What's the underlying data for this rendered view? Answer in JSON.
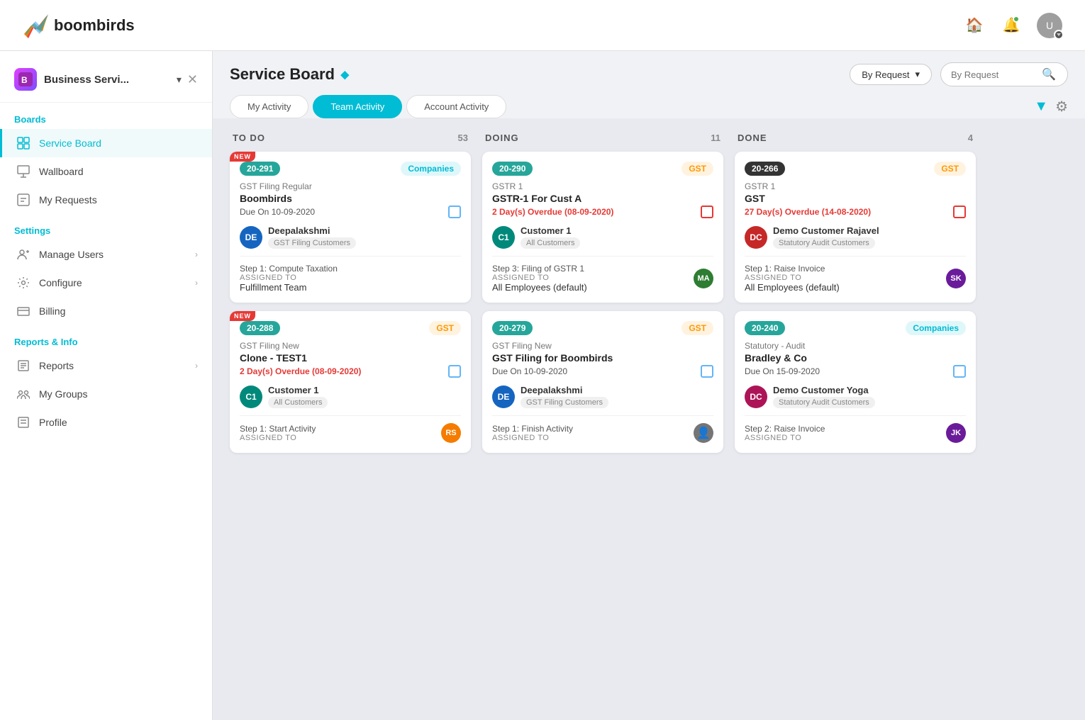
{
  "app": {
    "name": "boombirds"
  },
  "topnav": {
    "home_icon": "🏠",
    "bell_icon": "🔔",
    "avatar_initials": "U"
  },
  "sidebar": {
    "business_name": "Business Servi...",
    "sections": {
      "boards": {
        "label": "Boards",
        "items": [
          {
            "id": "service-board",
            "label": "Service Board",
            "active": true
          },
          {
            "id": "wallboard",
            "label": "Wallboard",
            "active": false
          },
          {
            "id": "my-requests",
            "label": "My Requests",
            "active": false
          }
        ]
      },
      "settings": {
        "label": "Settings",
        "items": [
          {
            "id": "manage-users",
            "label": "Manage Users",
            "has_arrow": true
          },
          {
            "id": "configure",
            "label": "Configure",
            "has_arrow": true
          },
          {
            "id": "billing",
            "label": "Billing",
            "has_arrow": false
          }
        ]
      },
      "reports": {
        "label": "Reports & Info",
        "items": [
          {
            "id": "reports",
            "label": "Reports",
            "has_arrow": true
          },
          {
            "id": "my-groups",
            "label": "My Groups",
            "has_arrow": false
          },
          {
            "id": "profile",
            "label": "Profile",
            "has_arrow": false
          }
        ]
      }
    }
  },
  "page": {
    "title": "Service Board",
    "filter_label": "By Request",
    "search_placeholder": "By Request",
    "tabs": [
      {
        "id": "my-activity",
        "label": "My Activity",
        "active": false
      },
      {
        "id": "team-activity",
        "label": "Team Activity",
        "active": true
      },
      {
        "id": "account-activity",
        "label": "Account Activity",
        "active": false
      }
    ]
  },
  "columns": [
    {
      "id": "todo",
      "title": "TO DO",
      "count": 53,
      "cards": [
        {
          "id": "20-291",
          "id_color": "green",
          "tag": "Companies",
          "tag_style": "teal",
          "is_new": true,
          "category": "GST Filing Regular",
          "name": "Boombirds",
          "due": "Due On 10-09-2020",
          "due_overdue": false,
          "due_icon": "square",
          "assignee_initials": "DE",
          "assignee_color": "av-blue",
          "assignee_name": "Deepalakshmi",
          "assignee_group": "GST Filing Customers",
          "step": "Step 1: Compute Taxation",
          "step_label": "ASSIGNED TO",
          "step_team": "Fulfillment Team",
          "step_avatar": null
        },
        {
          "id": "20-288",
          "id_color": "green",
          "tag": "GST",
          "tag_style": "orange",
          "is_new": true,
          "category": "GST Filing New",
          "name": "Clone - TEST1",
          "due": "2 Day(s) Overdue (08-09-2020)",
          "due_overdue": true,
          "due_icon": "square",
          "assignee_initials": "C1",
          "assignee_color": "av-teal",
          "assignee_name": "Customer 1",
          "assignee_group": "All Customers",
          "step": "Step 1: Start Activity",
          "step_label": "ASSIGNED TO",
          "step_team": "",
          "step_avatar_initials": "RS",
          "step_avatar_color": "av-orange"
        }
      ]
    },
    {
      "id": "doing",
      "title": "DOING",
      "count": 11,
      "cards": [
        {
          "id": "20-290",
          "id_color": "green",
          "tag": "GST",
          "tag_style": "orange",
          "is_new": false,
          "category": "GSTR 1",
          "name": "GSTR-1 For Cust A",
          "due": "2 Day(s) Overdue (08-09-2020)",
          "due_overdue": true,
          "due_icon": "square-red",
          "assignee_initials": "C1",
          "assignee_color": "av-teal",
          "assignee_name": "Customer 1",
          "assignee_group": "All Customers",
          "step": "Step 3: Filing of GSTR 1",
          "step_label": "ASSIGNED TO",
          "step_team": "All Employees (default)",
          "step_avatar_initials": "MA",
          "step_avatar_color": "av-green"
        },
        {
          "id": "20-279",
          "id_color": "green",
          "tag": "GST",
          "tag_style": "orange",
          "is_new": false,
          "category": "GST Filing New",
          "name": "GST Filing for Boombirds",
          "due": "Due On 10-09-2020",
          "due_overdue": false,
          "due_icon": "square",
          "assignee_initials": "DE",
          "assignee_color": "av-blue",
          "assignee_name": "Deepalakshmi",
          "assignee_group": "GST Filing Customers",
          "step": "Step 1: Finish Activity",
          "step_label": "ASSIGNED TO",
          "step_team": "",
          "step_avatar_initials": "👤",
          "step_avatar_color": "av-gray"
        }
      ]
    },
    {
      "id": "done",
      "title": "DONE",
      "count": 4,
      "cards": [
        {
          "id": "20-266",
          "id_color": "dark",
          "tag": "GST",
          "tag_style": "orange",
          "is_new": false,
          "category": "GSTR 1",
          "name": "GST",
          "due": "27 Day(s) Overdue (14-08-2020)",
          "due_overdue": true,
          "due_icon": "square-red",
          "assignee_initials": "DC",
          "assignee_color": "av-red",
          "assignee_name": "Demo Customer Rajavel",
          "assignee_group": "Statutory Audit Customers",
          "step": "Step 1: Raise Invoice",
          "step_label": "ASSIGNED TO",
          "step_team": "All Employees (default)",
          "step_avatar_initials": "SK",
          "step_avatar_color": "av-purple"
        },
        {
          "id": "20-240",
          "id_color": "green",
          "tag": "Companies",
          "tag_style": "teal",
          "is_new": false,
          "category": "Statutory - Audit",
          "name": "Bradley & Co",
          "due": "Due On 15-09-2020",
          "due_overdue": false,
          "due_icon": "square",
          "assignee_initials": "DC",
          "assignee_color": "av-pink",
          "assignee_name": "Demo Customer Yoga",
          "assignee_group": "Statutory Audit Customers",
          "step": "Step 2: Raise Invoice",
          "step_label": "ASSIGNED TO",
          "step_team": "",
          "step_avatar_initials": "JK",
          "step_avatar_color": "av-purple"
        }
      ]
    }
  ]
}
